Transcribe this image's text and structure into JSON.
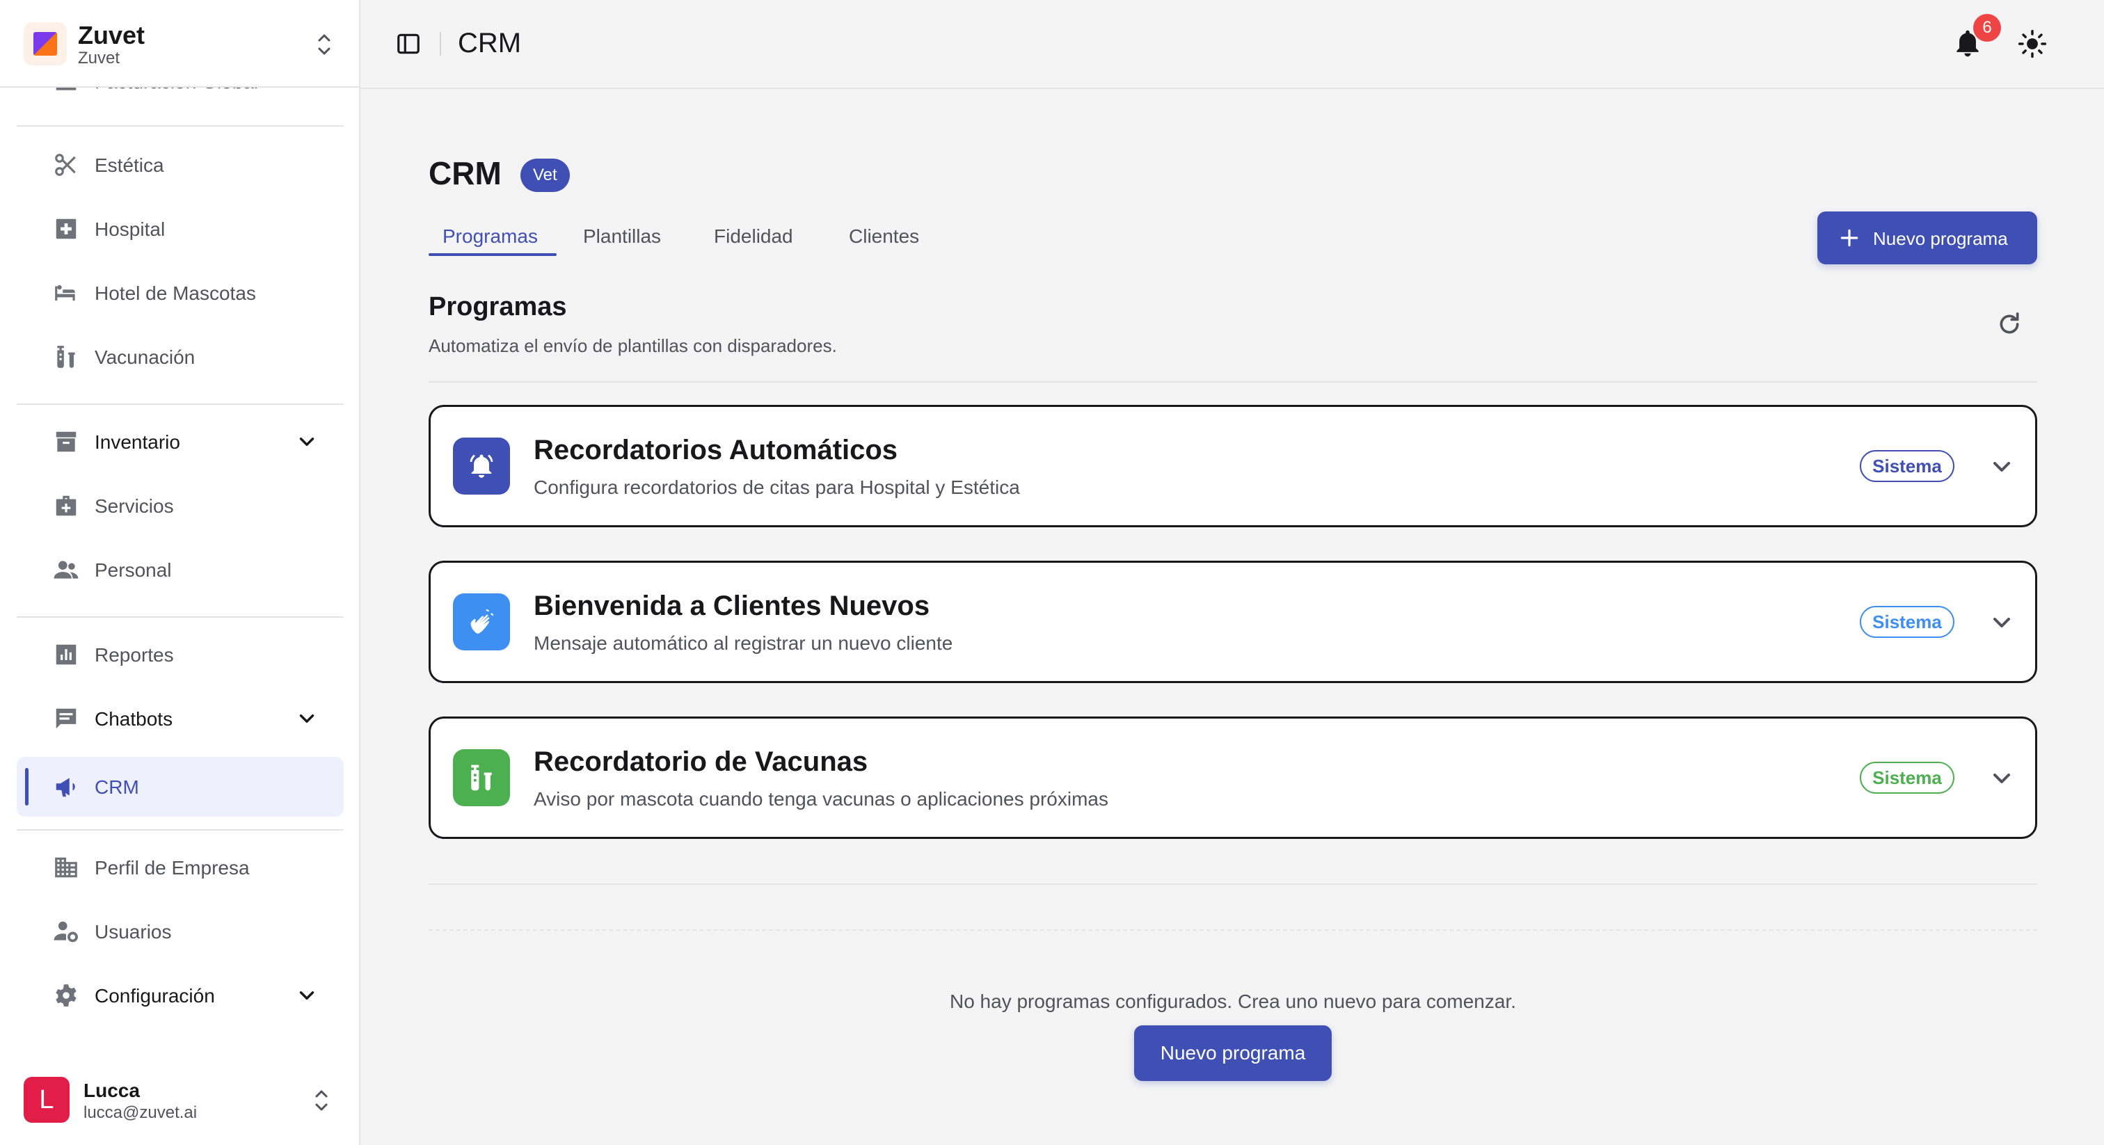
{
  "brand": {
    "name": "Zuvet",
    "subtitle": "Zuvet"
  },
  "sidebar": {
    "partial_item": "Facturación Global",
    "items": [
      {
        "label": "Estética",
        "icon": "scissors-icon"
      },
      {
        "label": "Hospital",
        "icon": "medical-cross-icon"
      },
      {
        "label": "Hotel de Mascotas",
        "icon": "bed-icon"
      },
      {
        "label": "Vacunación",
        "icon": "vaccine-icon"
      },
      {
        "label": "Inventario",
        "icon": "archive-box-icon"
      },
      {
        "label": "Servicios",
        "icon": "medical-bag-icon"
      },
      {
        "label": "Personal",
        "icon": "people-icon"
      },
      {
        "label": "Reportes",
        "icon": "bar-chart-icon"
      },
      {
        "label": "Chatbots",
        "icon": "chat-icon"
      },
      {
        "label": "CRM",
        "icon": "megaphone-icon"
      },
      {
        "label": "Perfil de Empresa",
        "icon": "building-icon"
      },
      {
        "label": "Usuarios",
        "icon": "user-gear-icon"
      },
      {
        "label": "Configuración",
        "icon": "gear-icon"
      }
    ]
  },
  "user": {
    "initial": "L",
    "name": "Lucca",
    "email": "lucca@zuvet.ai"
  },
  "header": {
    "title": "CRM",
    "notification_count": "6"
  },
  "page": {
    "title": "CRM",
    "tag": "Vet",
    "tabs": [
      "Programas",
      "Plantillas",
      "Fidelidad",
      "Clientes"
    ],
    "new_button": "Nuevo programa"
  },
  "section": {
    "title": "Programas",
    "subtitle": "Automatiza el envío de plantillas con disparadores."
  },
  "programs": [
    {
      "title": "Recordatorios Automáticos",
      "description": "Configura recordatorios de citas para Hospital y Estética",
      "badge": "Sistema",
      "color": "#3f4fb3",
      "icon": "bell-ring-icon"
    },
    {
      "title": "Bienvenida a Clientes Nuevos",
      "description": "Mensaje automático al registrar un nuevo cliente",
      "badge": "Sistema",
      "color": "#3d8ff2",
      "icon": "waving-hands-icon"
    },
    {
      "title": "Recordatorio de Vacunas",
      "description": "Aviso por mascota cuando tenga vacunas o aplicaciones próximas",
      "badge": "Sistema",
      "color": "#4caf50",
      "icon": "vaccine-icon"
    }
  ],
  "empty_state": {
    "message": "No hay programas configurados. Crea uno nuevo para comenzar.",
    "button": "Nuevo programa"
  },
  "colors": {
    "primary": "#3f4fb3",
    "notification": "#ef4444",
    "avatar": "#e11d48"
  }
}
